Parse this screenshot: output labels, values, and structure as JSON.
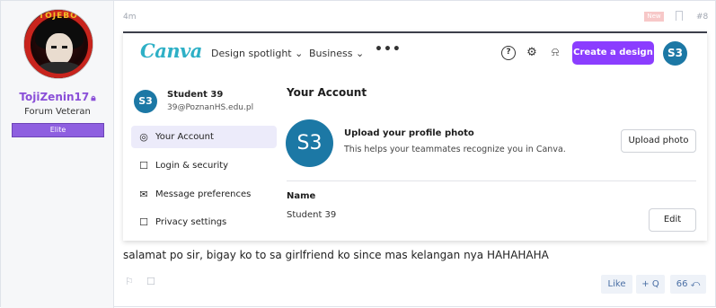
{
  "user": {
    "name": "TojiZenin17",
    "title": "Forum Veteran",
    "banner": "Elite",
    "avatar_text": "TOJEBO"
  },
  "post_meta": {
    "time": "4m",
    "new_badge": "New",
    "number": "#8"
  },
  "canva": {
    "logo": "Canva",
    "nav": [
      {
        "label": "Design spotlight"
      },
      {
        "label": "Business"
      }
    ],
    "more": "•••",
    "create_button": "Create a design",
    "avatar_initials": "S3",
    "sidebar": {
      "avatar_initials": "S3",
      "name": "Student 39",
      "email": "39@PoznanHS.edu.pl",
      "items": [
        {
          "label": "Your Account",
          "icon": "user-circle-icon"
        },
        {
          "label": "Login & security",
          "icon": "lock-icon"
        },
        {
          "label": "Message preferences",
          "icon": "envelope-icon"
        },
        {
          "label": "Privacy settings",
          "icon": "lock-icon"
        }
      ]
    },
    "main": {
      "title": "Your Account",
      "avatar_initials": "S3",
      "upload_title": "Upload your profile photo",
      "upload_desc": "This helps your teammates recognize you in Canva.",
      "upload_button": "Upload photo",
      "name_label": "Name",
      "name_value": "Student 39",
      "edit_button": "Edit"
    },
    "colors": {
      "brand": "#8b3dff",
      "avatar": "#1c78a5",
      "logo": "#2eb0c6"
    }
  },
  "post_text": "salamat po sir, bigay ko to sa girlfriend ko since mas kelangan nya HAHAHAHA",
  "footer": {
    "like": "Like",
    "quote": "+ Q",
    "reply": "66 ⤺",
    "colors": {
      "action": "#4a6fa5"
    }
  }
}
